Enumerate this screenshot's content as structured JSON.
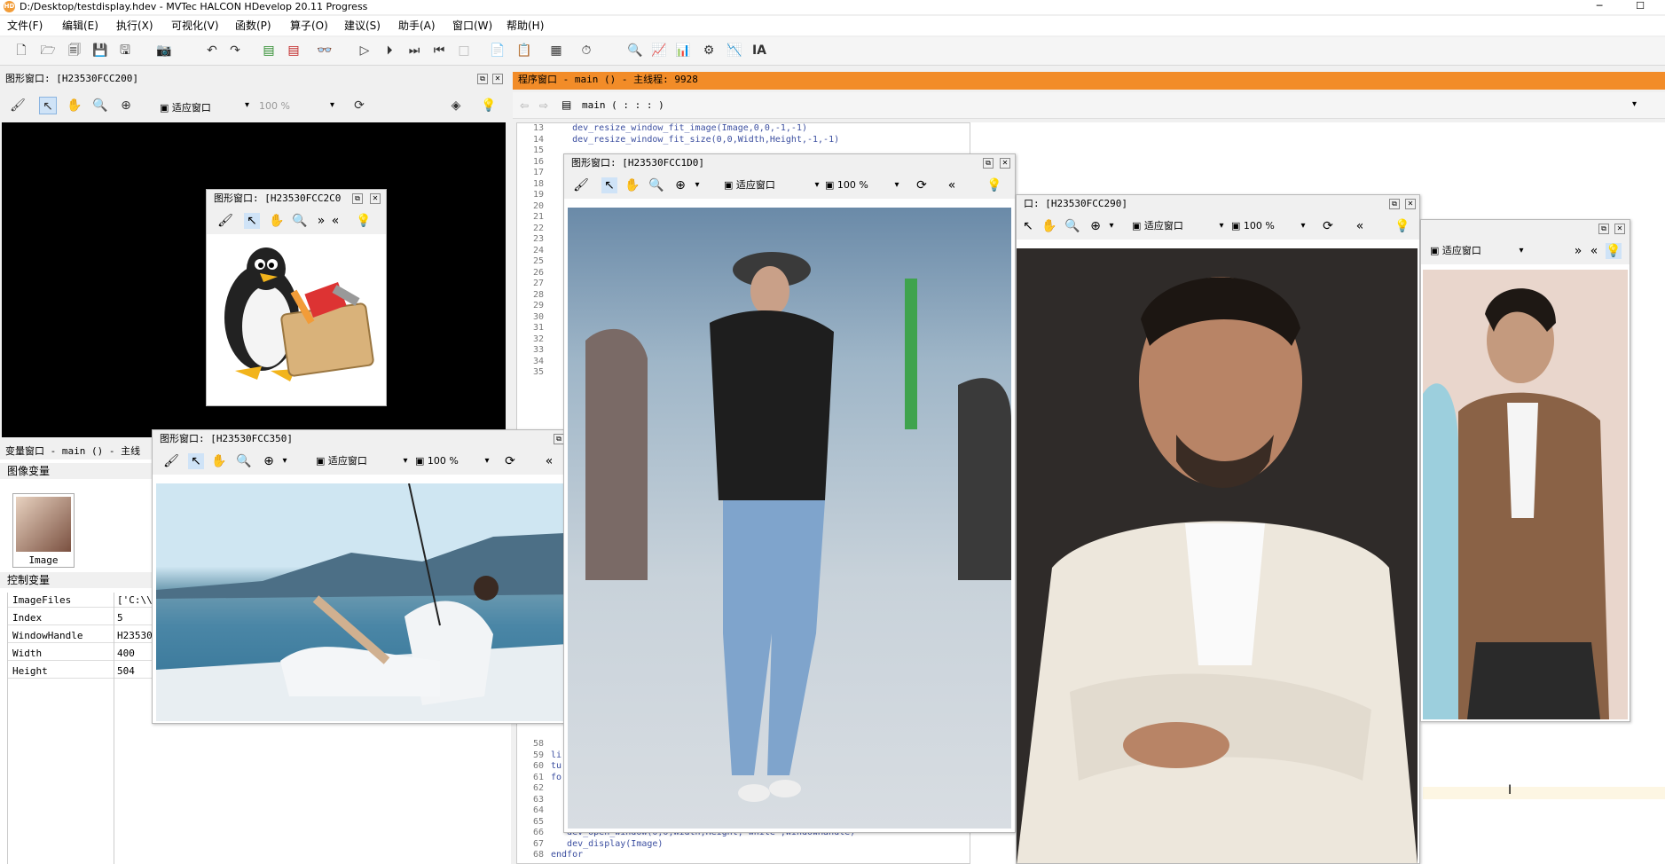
{
  "app": {
    "title": "D:/Desktop/testdisplay.hdev - MVTec HALCON HDevelop 20.11 Progress",
    "logo": "HD",
    "minimize": "─",
    "maximize": "☐"
  },
  "menu": [
    "文件(F)",
    "编辑(E)",
    "执行(X)",
    "可视化(V)",
    "函数(P)",
    "算子(O)",
    "建议(S)",
    "助手(A)",
    "窗口(W)",
    "帮助(H)"
  ],
  "graphics_main": {
    "title": "图形窗口: [H23530FCC200]",
    "fit_label": "适应窗口",
    "zoom": "100 %"
  },
  "program_window": {
    "title": "程序窗口 - main () - 主线程: 9928",
    "proc": "main ( : : : )",
    "accent": "#f28c28",
    "lines_top": [
      {
        "n": "13",
        "t": "    dev_resize_window_fit_image(Image,0,0,-1,-1)"
      },
      {
        "n": "14",
        "t": "    dev_resize_window_fit_size(0,0,Width,Height,-1,-1)"
      },
      {
        "n": "15",
        "t": ""
      },
      {
        "n": "16",
        "t": ""
      },
      {
        "n": "17",
        "t": ""
      },
      {
        "n": "18",
        "t": ""
      },
      {
        "n": "19",
        "t": ""
      },
      {
        "n": "20",
        "t": ""
      },
      {
        "n": "21",
        "t": ""
      },
      {
        "n": "22",
        "t": ""
      },
      {
        "n": "23",
        "t": ""
      },
      {
        "n": "24",
        "t": ""
      },
      {
        "n": "25",
        "t": ""
      },
      {
        "n": "26",
        "t": ""
      },
      {
        "n": "27",
        "t": ""
      },
      {
        "n": "28",
        "t": ""
      },
      {
        "n": "29",
        "t": ""
      },
      {
        "n": "30",
        "t": ""
      },
      {
        "n": "31",
        "t": ""
      },
      {
        "n": "32",
        "t": ""
      },
      {
        "n": "33",
        "t": ""
      },
      {
        "n": "34",
        "t": ""
      },
      {
        "n": "35",
        "t": ""
      }
    ],
    "lines_bottom": [
      {
        "n": "58",
        "t": ""
      },
      {
        "n": "59",
        "t": "li"
      },
      {
        "n": "60",
        "t": "tu"
      },
      {
        "n": "61",
        "t": "fo"
      },
      {
        "n": "62",
        "t": ""
      },
      {
        "n": "63",
        "t": ""
      },
      {
        "n": "64",
        "t": ""
      },
      {
        "n": "65",
        "t": ""
      },
      {
        "n": "66",
        "t": "   dev_open_window(0,0,Width,Height,'white',WindowHandle)"
      },
      {
        "n": "67",
        "t": "   dev_display(Image)"
      },
      {
        "n": "68",
        "t": "endfor"
      }
    ]
  },
  "variable_window": {
    "title": "变量窗口 - main () - 主线",
    "iconic_header": "图像变量",
    "iconic_label": "Image",
    "control_header": "控制变量",
    "vars": [
      {
        "name": "ImageFiles",
        "value": "['C:\\\\"
      },
      {
        "name": "Index",
        "value": "5"
      },
      {
        "name": "WindowHandle",
        "value": "H23530"
      },
      {
        "name": "Width",
        "value": "400"
      },
      {
        "name": "Height",
        "value": "504"
      }
    ]
  },
  "gw_penguin": {
    "title": "图形窗口: [H23530FCC2C0"
  },
  "gw_fishing": {
    "title": "图形窗口: [H23530FCC350]",
    "fit_label": "适应窗口",
    "zoom": "100 %"
  },
  "gw_airport": {
    "title": "图形窗口: [H23530FCC1D0]",
    "fit_label": "适应窗口",
    "zoom": "100 %"
  },
  "gw_portrait": {
    "title": "口: [H23530FCC290]",
    "fit_label": "适应窗口",
    "zoom": "100 %"
  },
  "gw_suit": {
    "fit_label": "适应窗口"
  },
  "icons": {
    "close": "✕",
    "restore": "⧉",
    "dropdown": "▾",
    "more": "»",
    "less": "«"
  }
}
